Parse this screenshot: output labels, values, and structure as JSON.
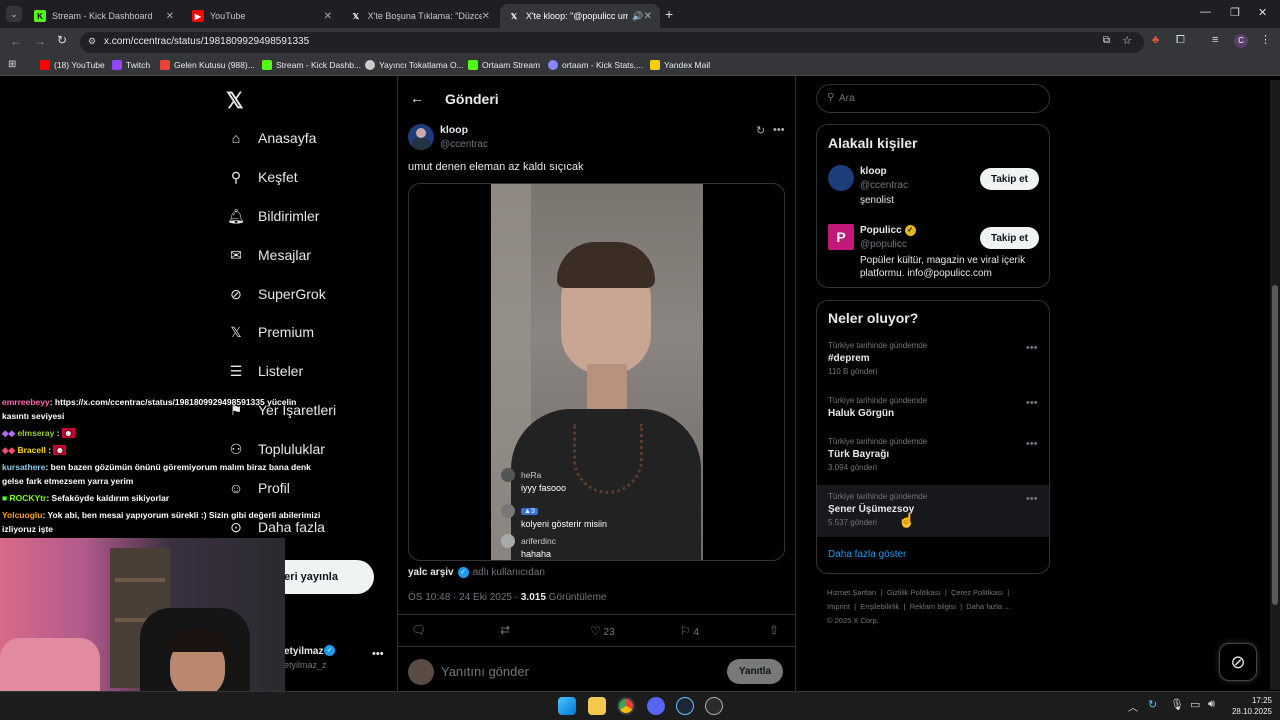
{
  "browser": {
    "tabs": [
      {
        "label": "Stream - Kick Dashboard",
        "favicon": "kick-icon",
        "color": "#53fc18"
      },
      {
        "label": "YouTube",
        "favicon": "youtube-icon",
        "color": "#ff0000"
      },
      {
        "label": "X'te Boşuna Tıklama: \"Düzce'de",
        "favicon": "x-icon",
        "color": "#ffffff"
      },
      {
        "label": "X'te kloop: \"@populicc umu",
        "favicon": "x-icon",
        "color": "#ffffff"
      }
    ],
    "url": "x.com/ccentrac/status/1981809929498591335",
    "bookmarks": [
      {
        "label": "(18) YouTube",
        "color": "#ff0000"
      },
      {
        "label": "Twitch",
        "color": "#9146ff"
      },
      {
        "label": "Gelen Kutusu (988)...",
        "color": "#ea4335"
      },
      {
        "label": "Stream - Kick Dashb...",
        "color": "#53fc18"
      },
      {
        "label": "Yayıncı Tokatlama O...",
        "color": "#cccccc"
      },
      {
        "label": "Ortaam Stream",
        "color": "#53fc18"
      },
      {
        "label": "ortaam - Kick Stats,...",
        "color": "#8888ff"
      },
      {
        "label": "Yandex Mail",
        "color": "#ffcc00"
      }
    ]
  },
  "nav": {
    "items": [
      "Anasayfa",
      "Keşfet",
      "Bildirimler",
      "Mesajlar",
      "SuperGrok",
      "Premium",
      "Listeler",
      "Yer İşaretleri",
      "Topluluklar",
      "Profil",
      "Daha fazla"
    ],
    "post_button": "eri yayınla",
    "account_name": "etyilmaz",
    "account_handle": "etyilmaz_z"
  },
  "post": {
    "header_title": "Gönderi",
    "author_name": "kloop",
    "author_handle": "@ccentrac",
    "text": "umut denen eleman az kaldı sıçıcak",
    "video_comments": [
      {
        "user": "heRa",
        "text": "iyyy fasooo"
      },
      {
        "user": "",
        "text": "kolyeni gösterir misiin"
      },
      {
        "user": "ariferdinc",
        "text": "hahaha"
      }
    ],
    "quote_name": "yalc arşiv",
    "quote_suffix": "adlı kullanıcıdan",
    "time": "ÖS 10:48 · 24 Eki 2025 ·",
    "views_count": "3.015",
    "views_label": "Görüntüleme",
    "likes": "23",
    "bookmarks": "4",
    "reply_placeholder": "Yanıtını gönder",
    "reply_button": "Yanıtla"
  },
  "sidebar": {
    "search_placeholder": "Ara",
    "related_title": "Alakalı kişiler",
    "people": [
      {
        "name": "kloop",
        "handle": "@ccentrac",
        "bio": "şenolist",
        "button": "Takip et"
      },
      {
        "name": "Populicc",
        "handle": "@populicc",
        "bio": "Popüler kültür, magazin ve viral içerik platformu. info@populicc.com",
        "button": "Takip et"
      }
    ],
    "trends_title": "Neler oluyor?",
    "trends": [
      {
        "meta": "Türkiye tarihinde gündemde",
        "title": "#deprem",
        "count": "110 B gönderi"
      },
      {
        "meta": "Türkiye tarihinde gündemde",
        "title": "Haluk Görgün",
        "count": ""
      },
      {
        "meta": "Türkiye tarihinde gündemde",
        "title": "Türk Bayrağı",
        "count": "3.094 gönderi"
      },
      {
        "meta": "Türkiye tarihinde gündemde",
        "title": "Şener Üşümezsoy",
        "count": "5.537 gönderi"
      }
    ],
    "show_more": "Daha fazla göster",
    "footer_line1": [
      "Hizmet Şartları",
      "Gizlilik Politikası",
      "Çerez Politikası"
    ],
    "footer_line2": [
      "Imprint",
      "Erişilebilirlik",
      "Reklam bilgisi",
      "Daha fazla ..."
    ],
    "copyright": "© 2025 X Corp."
  },
  "chat": [
    {
      "user": "emrreebeyy",
      "color": "#ff69b4",
      "text": ": https://x.com/ccentrac/status/1981809929498591335 yücelin"
    },
    {
      "user": "",
      "color": "#fff",
      "text": "kasıntı seviyesi"
    },
    {
      "user": "elmseray",
      "color": "#9acd32",
      "text": ":"
    },
    {
      "user": "Bracell",
      "color": "#ffd700",
      "text": ":"
    },
    {
      "user": "kursathere",
      "color": "#87ceeb",
      "text": ": ben bazen gözümün önünü göremiyorum malım biraz bana denk"
    },
    {
      "user": "",
      "color": "#fff",
      "text": "gelse fark etmezsem yarra yerim"
    },
    {
      "user": "ROCKYtr",
      "color": "#7fff00",
      "text": ": Sefaköyde kaldırım sikiyorlar"
    },
    {
      "user": "Yolcuoglu",
      "color": "#ffa500",
      "text": ": Yok abi, ben mesai yapıyorum sürekli :) Sizin gibi değerli abilerimizi"
    },
    {
      "user": "",
      "color": "#fff",
      "text": "izliyoruz işte"
    }
  ],
  "taskbar": {
    "time": "17:25",
    "date": "28.10.2025"
  }
}
